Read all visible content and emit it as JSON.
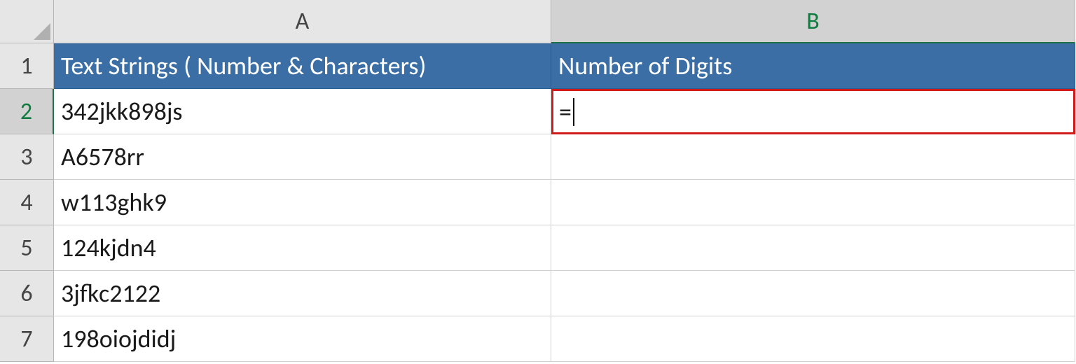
{
  "columns": [
    "A",
    "B"
  ],
  "active_column_index": 1,
  "active_row_index": 1,
  "header_row": {
    "A": "Text Strings ( Number & Characters)",
    "B": "Number of Digits"
  },
  "rows": [
    {
      "num": "1",
      "A": "",
      "B": ""
    },
    {
      "num": "2",
      "A": "342jkk898js",
      "B": "="
    },
    {
      "num": "3",
      "A": "A6578rr",
      "B": ""
    },
    {
      "num": "4",
      "A": "w113ghk9",
      "B": ""
    },
    {
      "num": "5",
      "A": "124kjdn4",
      "B": ""
    },
    {
      "num": "6",
      "A": "3jfkc2122",
      "B": ""
    },
    {
      "num": "7",
      "A": "198oiojdidj",
      "B": ""
    }
  ],
  "editing_cell": "B2",
  "colors": {
    "header_fill": "#3a6ea5",
    "highlight_border": "#d11a1a"
  }
}
